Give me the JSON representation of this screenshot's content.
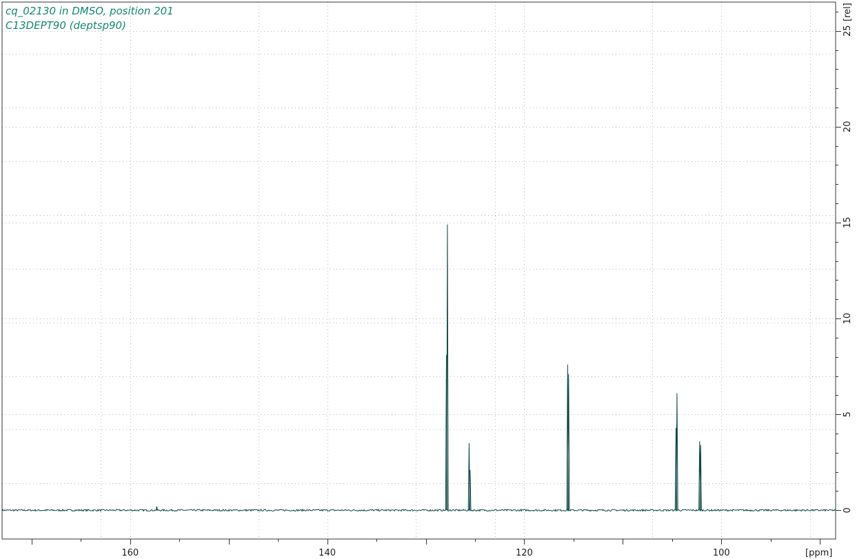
{
  "window": {
    "title_line1": "cq_02130 in DMSO, position 201",
    "title_line2": "C13DEPT90 (deptsp90)"
  },
  "colors": {
    "title": "#12886e",
    "spectrum": "#0d4744",
    "frame": "#333333",
    "grid": "#b8b8b8"
  },
  "chart_data": {
    "type": "line",
    "title": "cq_02130 in DMSO, position 201",
    "subtitle": "C13DEPT90 (deptsp90)",
    "xlabel": "[ppm]",
    "ylabel": "[rel]",
    "x_reversed": true,
    "xlim": [
      173.0,
      88.4
    ],
    "ylim": [
      -1.5,
      26.5
    ],
    "x_ticks": [
      160,
      140,
      120,
      100
    ],
    "x_tick_labels": [
      "160",
      "140",
      "120",
      "100"
    ],
    "x_grid": [
      163,
      147,
      131,
      123,
      107,
      91
    ],
    "y_ticks": [
      0,
      5,
      10,
      15,
      20,
      25
    ],
    "y_tick_labels": [
      "0",
      "5",
      "10",
      "15",
      "20",
      "25"
    ],
    "y_grid": [
      1.4,
      4.2,
      7.0,
      9.8,
      12.6,
      15.4,
      18.2,
      21.0,
      23.8
    ],
    "grid": true,
    "baseline": 0,
    "series": [
      {
        "peaks": [
          {
            "ppm": 157.3,
            "height": 0.2
          },
          {
            "ppm": 127.8,
            "height": 14.9
          },
          {
            "ppm": 127.9,
            "height": 8.1
          },
          {
            "ppm": 125.6,
            "height": 3.5
          },
          {
            "ppm": 125.5,
            "height": 2.1
          },
          {
            "ppm": 115.6,
            "height": 7.6
          },
          {
            "ppm": 115.5,
            "height": 7.1
          },
          {
            "ppm": 104.5,
            "height": 6.1
          },
          {
            "ppm": 104.6,
            "height": 4.3
          },
          {
            "ppm": 102.2,
            "height": 3.6
          },
          {
            "ppm": 102.1,
            "height": 3.4
          }
        ]
      }
    ]
  }
}
